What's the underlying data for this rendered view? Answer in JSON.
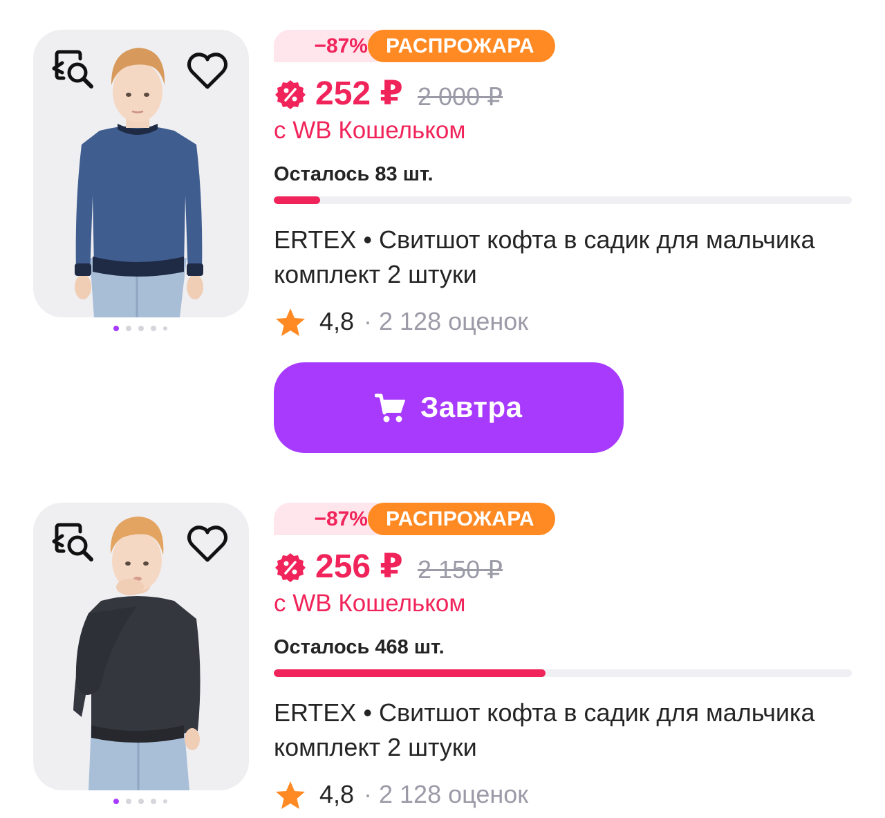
{
  "colors": {
    "accent": "#a73afd",
    "price": "#f0245a",
    "sale_badge": "#ff8a24",
    "discount_badge_bg": "#ffe6ec",
    "star": "#ff8a24",
    "muted": "#9b9aa7"
  },
  "icons": {
    "find_similar": "find-similar-icon",
    "favorite": "heart-icon",
    "wallet": "wb-wallet-badge-icon",
    "rating": "star-icon",
    "cart": "cart-icon"
  },
  "products": [
    {
      "discount": "−87%",
      "sale_label": "РАСПРОЖАРА",
      "price": "252 ₽",
      "old_price": "2 000 ₽",
      "wallet_note": "с WB Кошельком",
      "stock_text": "Осталось 83 шт.",
      "stock_level": 0.08,
      "title": "ERTEX • Свитшот кофта в садик для мальчика комплект 2 штуки",
      "rating": "4,8",
      "separator": "·",
      "reviews": "2 128 оценок",
      "delivery_button": "Завтра",
      "photo_count": 5,
      "active_photo": 1
    },
    {
      "discount": "−87%",
      "sale_label": "РАСПРОЖАРА",
      "price": "256 ₽",
      "old_price": "2 150 ₽",
      "wallet_note": "с WB Кошельком",
      "stock_text": "Осталось 468 шт.",
      "stock_level": 0.47,
      "title": "ERTEX • Свитшот кофта в садик для мальчика комплект 2 штуки",
      "rating": "4,8",
      "separator": "·",
      "reviews": "2 128 оценок",
      "photo_count": 5,
      "active_photo": 1
    }
  ]
}
